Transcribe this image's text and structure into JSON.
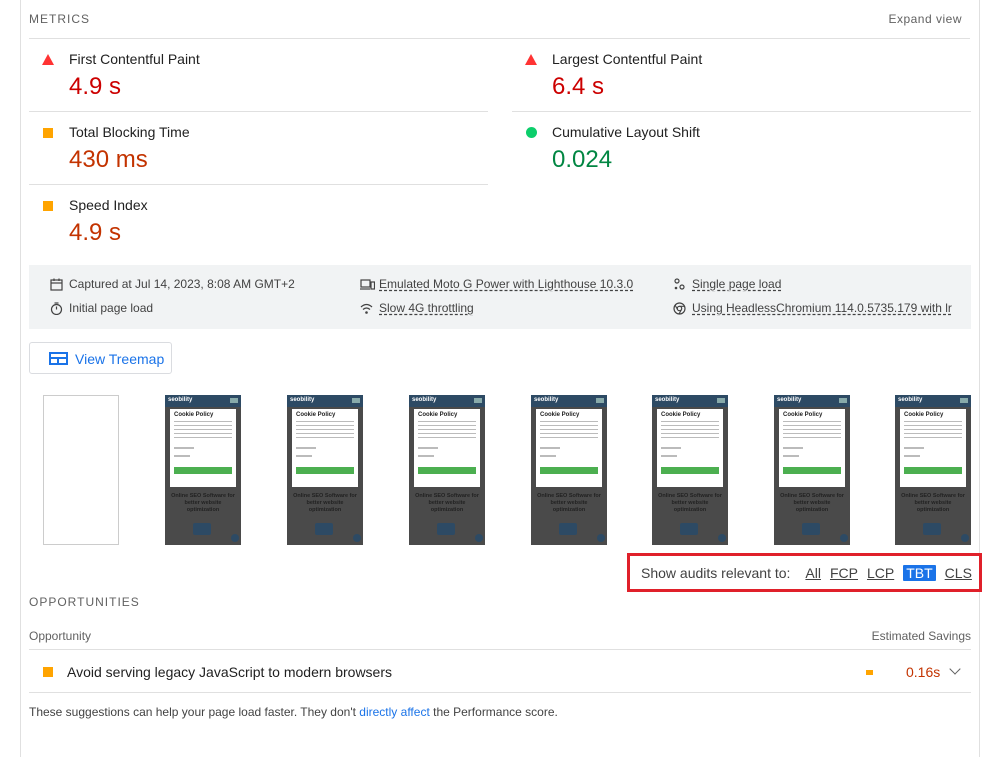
{
  "metrics": {
    "title": "METRICS",
    "expand_label": "Expand view",
    "items": [
      {
        "label": "First Contentful Paint",
        "value": "4.9 s",
        "status": "fail"
      },
      {
        "label": "Largest Contentful Paint",
        "value": "6.4 s",
        "status": "fail"
      },
      {
        "label": "Total Blocking Time",
        "value": "430 ms",
        "status": "average"
      },
      {
        "label": "Cumulative Layout Shift",
        "value": "0.024",
        "status": "pass"
      },
      {
        "label": "Speed Index",
        "value": "4.9 s",
        "status": "average"
      }
    ]
  },
  "runtime_info": {
    "captured": "Captured at Jul 14, 2023, 8:08 AM GMT+2",
    "initial_load": "Initial page load",
    "device": "Emulated Moto G Power with Lighthouse 10.3.0",
    "throttling": "Slow 4G throttling",
    "page_load": "Single page load",
    "browser": "Using HeadlessChromium 114.0.5735.179 with lr"
  },
  "treemap_button": {
    "label": "View Treemap"
  },
  "filmstrip": {
    "card_title": "Cookie Policy",
    "headline": "Online SEO Software for better website optimization",
    "logo": "seobility"
  },
  "audit_filter": {
    "label": "Show audits relevant to:",
    "options": [
      "All",
      "FCP",
      "LCP",
      "TBT",
      "CLS"
    ],
    "active": "TBT"
  },
  "opportunities": {
    "title": "OPPORTUNITIES",
    "col_left": "Opportunity",
    "col_right": "Estimated Savings",
    "items": [
      {
        "label": "Avoid serving legacy JavaScript to modern browsers",
        "savings": "0.16s"
      }
    ]
  },
  "footer": {
    "before": "These suggestions can help your page load faster. They don't ",
    "link": "directly affect",
    "after": " the Performance score."
  },
  "colors": {
    "fail": "#ff3333",
    "average": "#ffa400",
    "pass": "#0cce6b",
    "accent": "#1a73e8",
    "highlight_border": "#e0202a"
  }
}
